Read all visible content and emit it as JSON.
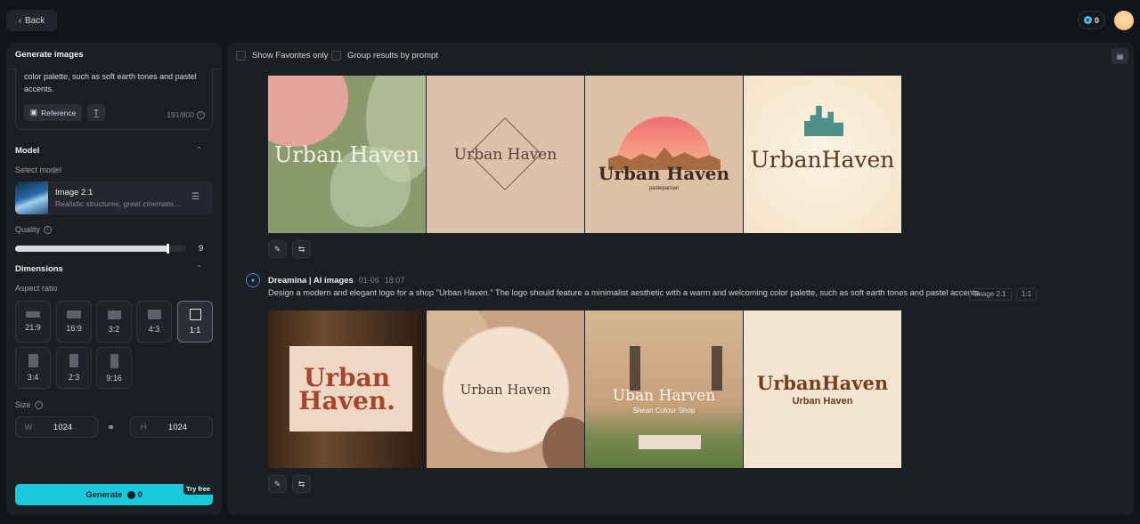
{
  "header": {
    "back_label": "Back",
    "credits": "0"
  },
  "sidebar": {
    "tab_label": "Generate images",
    "prompt_text": "color palette, such as soft earth tones and pastel accents.",
    "reference_label": "Reference",
    "char_count": "191/800",
    "model_section": "Model",
    "select_model_label": "Select model",
    "model_name": "Image 2.1",
    "model_desc": "Realistic structures, great cinematography",
    "quality_label": "Quality",
    "quality_value": "9",
    "quality_level": 0.9,
    "dimensions_section": "Dimensions",
    "aspect_label": "Aspect ratio",
    "aspect_ratios": [
      "21:9",
      "16:9",
      "3:2",
      "4:3",
      "1:1",
      "3:4",
      "2:3",
      "9:16"
    ],
    "selected_ratio": "1:1",
    "size_label": "Size",
    "width_prefix": "W",
    "width_value": "1024",
    "height_prefix": "H",
    "height_value": "1024",
    "generate_label": "Generate",
    "generate_cost": "0",
    "try_free_label": "Try free"
  },
  "results": {
    "show_favorites_label": "Show Favorites only",
    "group_by_prompt_label": "Group results by prompt",
    "group1": {
      "images": [
        {
          "text": "Urban Haven",
          "sub": ""
        },
        {
          "text": "Urban Haven",
          "sub": ""
        },
        {
          "text": "Urban Haven",
          "sub": "pasteparoan"
        },
        {
          "text": "UrbanHaven",
          "sub": ""
        }
      ]
    },
    "group2": {
      "author": "Dreamina | AI images",
      "date": "01-06",
      "time": "18:07",
      "prompt": "Design a modern and elegant logo for a shop \"Urban Haven.\" The logo should feature a minimalist aesthetic with a warm and welcoming color palette, such as soft earth tones and pastel accents.",
      "model_tag": "Image 2.1",
      "ratio_tag": "1:1",
      "images": [
        {
          "text": "Urban Haven.",
          "sub": ""
        },
        {
          "text": "Urban Haven",
          "sub": ""
        },
        {
          "text": "Uban Harven",
          "sub": "Shean Colour Shop"
        },
        {
          "text": "UrbanHaven",
          "sub": "Urban Haven"
        }
      ]
    }
  },
  "colors": {
    "accent": "#18c8dd",
    "background": "#111419",
    "panel": "#1b1e23"
  }
}
